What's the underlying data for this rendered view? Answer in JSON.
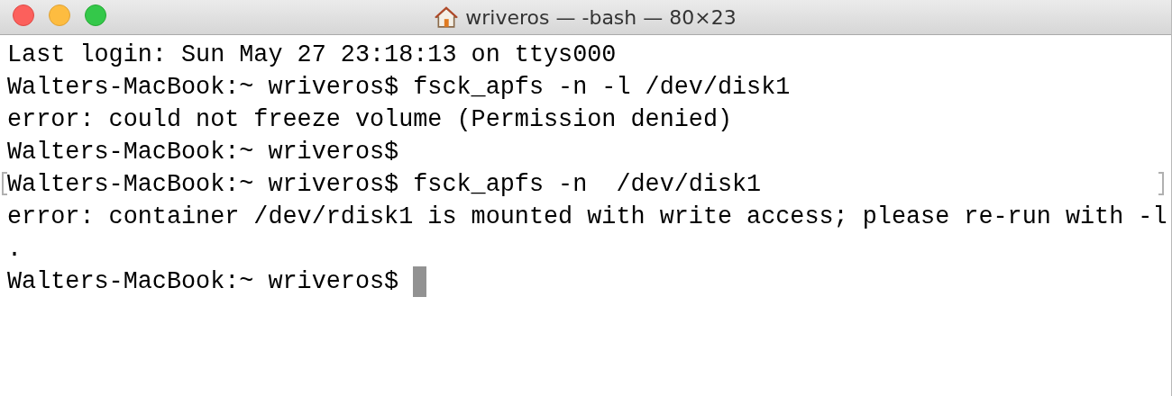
{
  "window": {
    "title": "wriveros — -bash — 80×23"
  },
  "terminal": {
    "lines": [
      {
        "text": "Last login: Sun May 27 23:18:13 on ttys000",
        "marked": false,
        "cursor": false
      },
      {
        "text": "Walters-MacBook:~ wriveros$ fsck_apfs -n -l /dev/disk1",
        "marked": false,
        "cursor": false
      },
      {
        "text": "error: could not freeze volume (Permission denied)",
        "marked": false,
        "cursor": false
      },
      {
        "text": "Walters-MacBook:~ wriveros$",
        "marked": false,
        "cursor": false
      },
      {
        "text": "Walters-MacBook:~ wriveros$ fsck_apfs -n  /dev/disk1",
        "marked": true,
        "cursor": false
      },
      {
        "text": "error: container /dev/rdisk1 is mounted with write access; please re-run with -l",
        "marked": false,
        "cursor": false
      },
      {
        "text": ".",
        "marked": false,
        "cursor": false
      },
      {
        "text": "Walters-MacBook:~ wriveros$ ",
        "marked": false,
        "cursor": true
      }
    ]
  }
}
